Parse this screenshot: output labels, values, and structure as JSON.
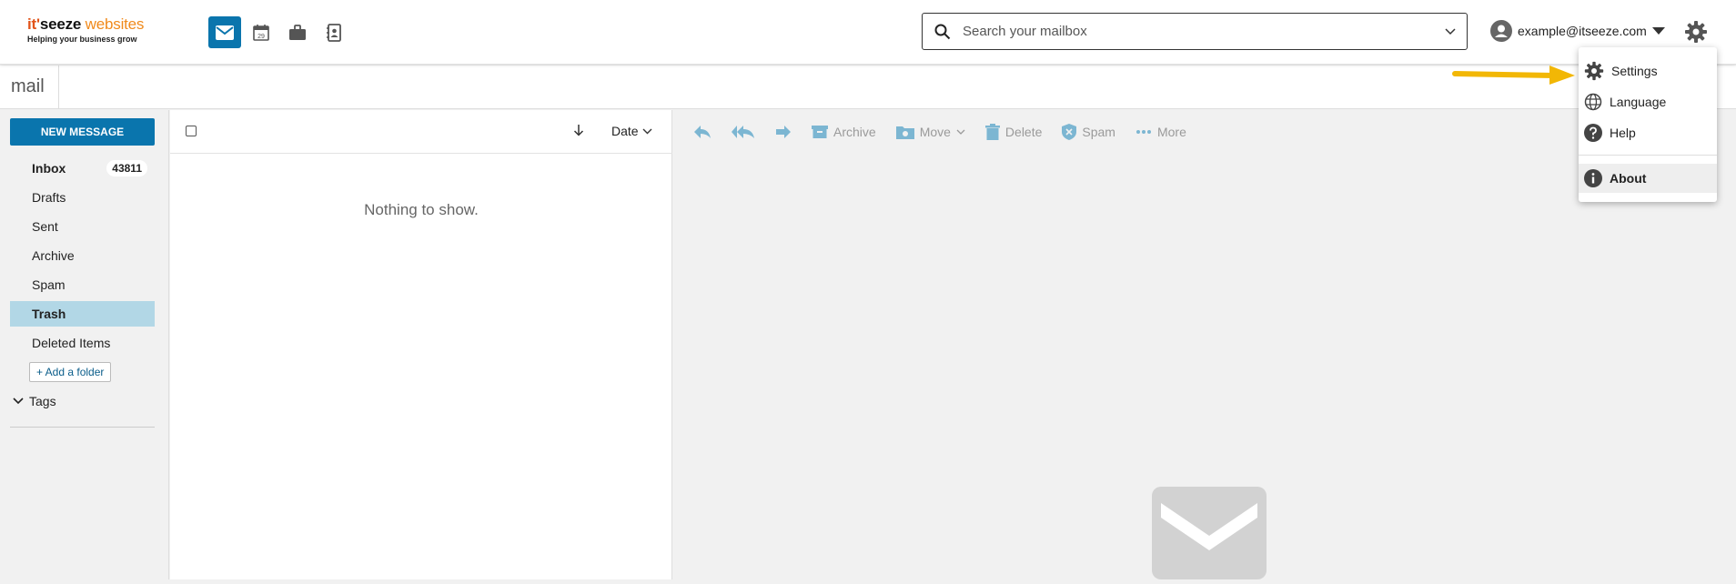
{
  "brand": {
    "name_part1": "it'",
    "name_part2": "seeze",
    "name_part3": " websites",
    "tagline": "Helping your business grow"
  },
  "header": {
    "apps": [
      {
        "name": "mail-icon",
        "active": true
      },
      {
        "name": "calendar-icon",
        "label": "29"
      },
      {
        "name": "briefcase-icon"
      },
      {
        "name": "contacts-icon"
      }
    ],
    "search_placeholder": "Search your mailbox",
    "account_email": "example@itseeze.com"
  },
  "subbar": {
    "title": "mail"
  },
  "sidebar": {
    "new_message": "NEW MESSAGE",
    "folders": [
      {
        "label": "Inbox",
        "count": "43811"
      },
      {
        "label": "Drafts"
      },
      {
        "label": "Sent"
      },
      {
        "label": "Archive"
      },
      {
        "label": "Spam"
      },
      {
        "label": "Trash"
      },
      {
        "label": "Deleted Items"
      }
    ],
    "add_folder": "+ Add a folder",
    "tags": "Tags"
  },
  "list": {
    "sort_label": "Date",
    "empty_text": "Nothing to show."
  },
  "toolbar": {
    "archive": "Archive",
    "move": "Move",
    "delete": "Delete",
    "spam": "Spam",
    "more": "More"
  },
  "settings_menu": {
    "items": [
      "Settings",
      "Language",
      "Help",
      "About"
    ]
  },
  "colors": {
    "accent": "#0a75ad",
    "selected_folder": "#b2d7e6",
    "annotation_arrow": "#f2b705"
  }
}
